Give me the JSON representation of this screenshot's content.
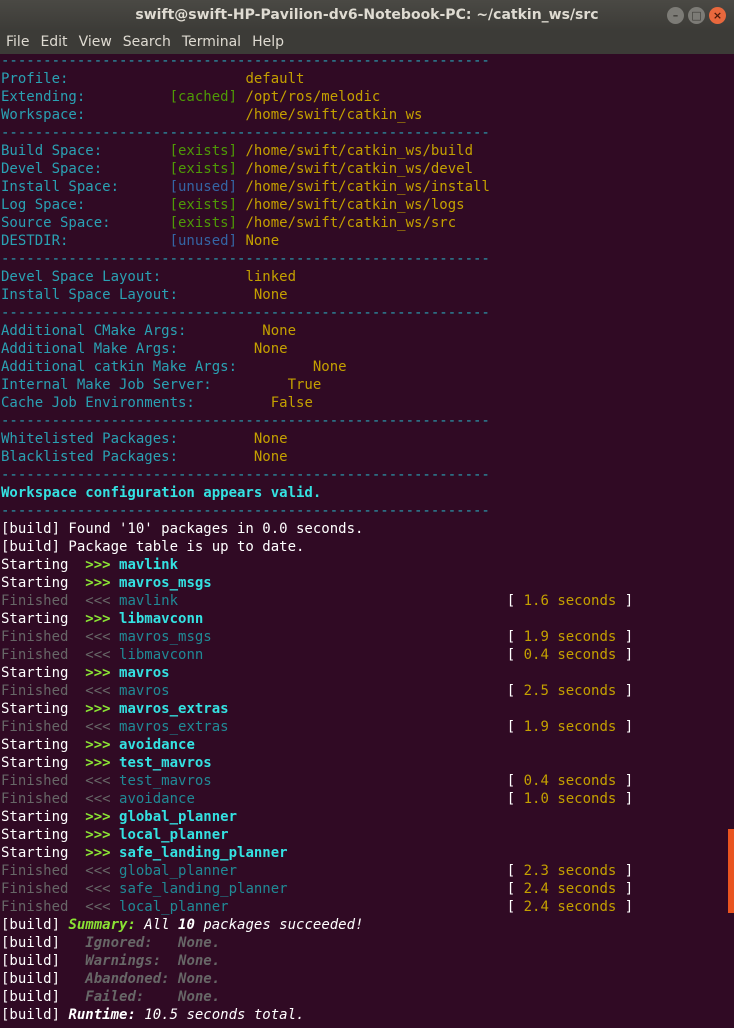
{
  "window": {
    "title": "swift@swift-HP-Pavilion-dv6-Notebook-PC: ~/catkin_ws/src"
  },
  "menu": [
    "File",
    "Edit",
    "View",
    "Search",
    "Terminal",
    "Help"
  ],
  "terminal": {
    "separator": "----------------------------------------------------------",
    "config_groups": [
      [
        {
          "label": "Profile:",
          "tag": "",
          "value": "default"
        },
        {
          "label": "Extending:",
          "tag": "[cached]",
          "tag_type": "ok",
          "value": "/opt/ros/melodic"
        },
        {
          "label": "Workspace:",
          "tag": "",
          "value": "/home/swift/catkin_ws"
        }
      ],
      [
        {
          "label": "Build Space:",
          "tag": "[exists]",
          "tag_type": "ok",
          "value": "/home/swift/catkin_ws/build"
        },
        {
          "label": "Devel Space:",
          "tag": "[exists]",
          "tag_type": "ok",
          "value": "/home/swift/catkin_ws/devel"
        },
        {
          "label": "Install Space:",
          "tag": "[unused]",
          "tag_type": "unused",
          "value": "/home/swift/catkin_ws/install"
        },
        {
          "label": "Log Space:",
          "tag": "[exists]",
          "tag_type": "ok",
          "value": "/home/swift/catkin_ws/logs"
        },
        {
          "label": "Source Space:",
          "tag": "[exists]",
          "tag_type": "ok",
          "value": "/home/swift/catkin_ws/src"
        },
        {
          "label": "DESTDIR:",
          "tag": "[unused]",
          "tag_type": "unused",
          "value": "None"
        }
      ],
      [
        {
          "label": "Devel Space Layout:",
          "tag": "",
          "value": "linked"
        },
        {
          "label": "Install Space Layout:",
          "tag": "",
          "value": "None"
        }
      ],
      [
        {
          "label": "Additional CMake Args:",
          "tag": "",
          "value": "None"
        },
        {
          "label": "Additional Make Args:",
          "tag": "",
          "value": "None"
        },
        {
          "label": "Additional catkin Make Args:",
          "tag": "",
          "value": "None"
        },
        {
          "label": "Internal Make Job Server:",
          "tag": "",
          "value": "True"
        },
        {
          "label": "Cache Job Environments:",
          "tag": "",
          "value": "False"
        }
      ],
      [
        {
          "label": "Whitelisted Packages:",
          "tag": "",
          "value": "None"
        },
        {
          "label": "Blacklisted Packages:",
          "tag": "",
          "value": "None"
        }
      ]
    ],
    "valid_message": "Workspace configuration appears valid.",
    "build_messages": [
      "[build] Found '10' packages in 0.0 seconds.",
      "[build] Package table is up to date."
    ],
    "jobs": [
      {
        "kind": "Starting",
        "pkg": "mavlink"
      },
      {
        "kind": "Starting",
        "pkg": "mavros_msgs"
      },
      {
        "kind": "Finished",
        "pkg": "mavlink",
        "time": "1.6 seconds"
      },
      {
        "kind": "Starting",
        "pkg": "libmavconn"
      },
      {
        "kind": "Finished",
        "pkg": "mavros_msgs",
        "time": "1.9 seconds"
      },
      {
        "kind": "Finished",
        "pkg": "libmavconn",
        "time": "0.4 seconds"
      },
      {
        "kind": "Starting",
        "pkg": "mavros"
      },
      {
        "kind": "Finished",
        "pkg": "mavros",
        "time": "2.5 seconds"
      },
      {
        "kind": "Starting",
        "pkg": "mavros_extras"
      },
      {
        "kind": "Finished",
        "pkg": "mavros_extras",
        "time": "1.9 seconds"
      },
      {
        "kind": "Starting",
        "pkg": "avoidance"
      },
      {
        "kind": "Starting",
        "pkg": "test_mavros"
      },
      {
        "kind": "Finished",
        "pkg": "test_mavros",
        "time": "0.4 seconds"
      },
      {
        "kind": "Finished",
        "pkg": "avoidance",
        "time": "1.0 seconds"
      },
      {
        "kind": "Starting",
        "pkg": "global_planner"
      },
      {
        "kind": "Starting",
        "pkg": "local_planner"
      },
      {
        "kind": "Starting",
        "pkg": "safe_landing_planner"
      },
      {
        "kind": "Finished",
        "pkg": "global_planner",
        "time": "2.3 seconds"
      },
      {
        "kind": "Finished",
        "pkg": "safe_landing_planner",
        "time": "2.4 seconds"
      },
      {
        "kind": "Finished",
        "pkg": "local_planner",
        "time": "2.4 seconds"
      }
    ],
    "summary": {
      "prefix": "[build]",
      "label": "Summary:",
      "pre": "All",
      "count": "10",
      "post": "packages succeeded!",
      "details": [
        {
          "label": "Ignored:",
          "value": "None."
        },
        {
          "label": "Warnings:",
          "value": "None."
        },
        {
          "label": "Abandoned:",
          "value": "None."
        },
        {
          "label": "Failed:",
          "value": "None."
        }
      ],
      "runtime_label": "Runtime:",
      "runtime_value": "10.5 seconds total."
    }
  },
  "colors": {
    "background": "#300a24",
    "accent": "#e95420"
  }
}
